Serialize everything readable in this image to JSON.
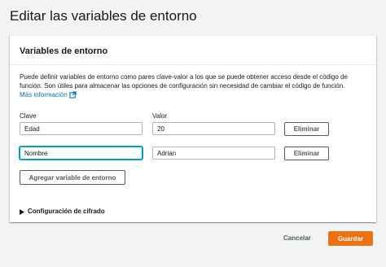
{
  "page": {
    "title": "Editar las variables de entorno"
  },
  "panel": {
    "title": "Variables de entorno",
    "description": "Puede definir variables de entorno como pares clave-valor a los que se puede obtener acceso desde el código de función. Son útiles para almacenar las opciones de configuración sin necesidad de cambiar el código de función.",
    "more_info": "Más información",
    "more_info_icon": "external-link-icon",
    "key_label": "Clave",
    "value_label": "Valor",
    "rows": [
      {
        "key": "Edad",
        "value": "20",
        "remove_label": "Eliminar"
      },
      {
        "key": "Nombre",
        "value": "Adrian",
        "remove_label": "Eliminar"
      }
    ],
    "add_label": "Agregar variable de entorno",
    "encryption_label": "Configuración de cifrado",
    "encryption_icon": "caret-right-icon"
  },
  "footer": {
    "cancel_label": "Cancelar",
    "save_label": "Guardar"
  },
  "colors": {
    "accent": "#ec7211",
    "link": "#0073bb",
    "focus": "#00a1c9"
  }
}
